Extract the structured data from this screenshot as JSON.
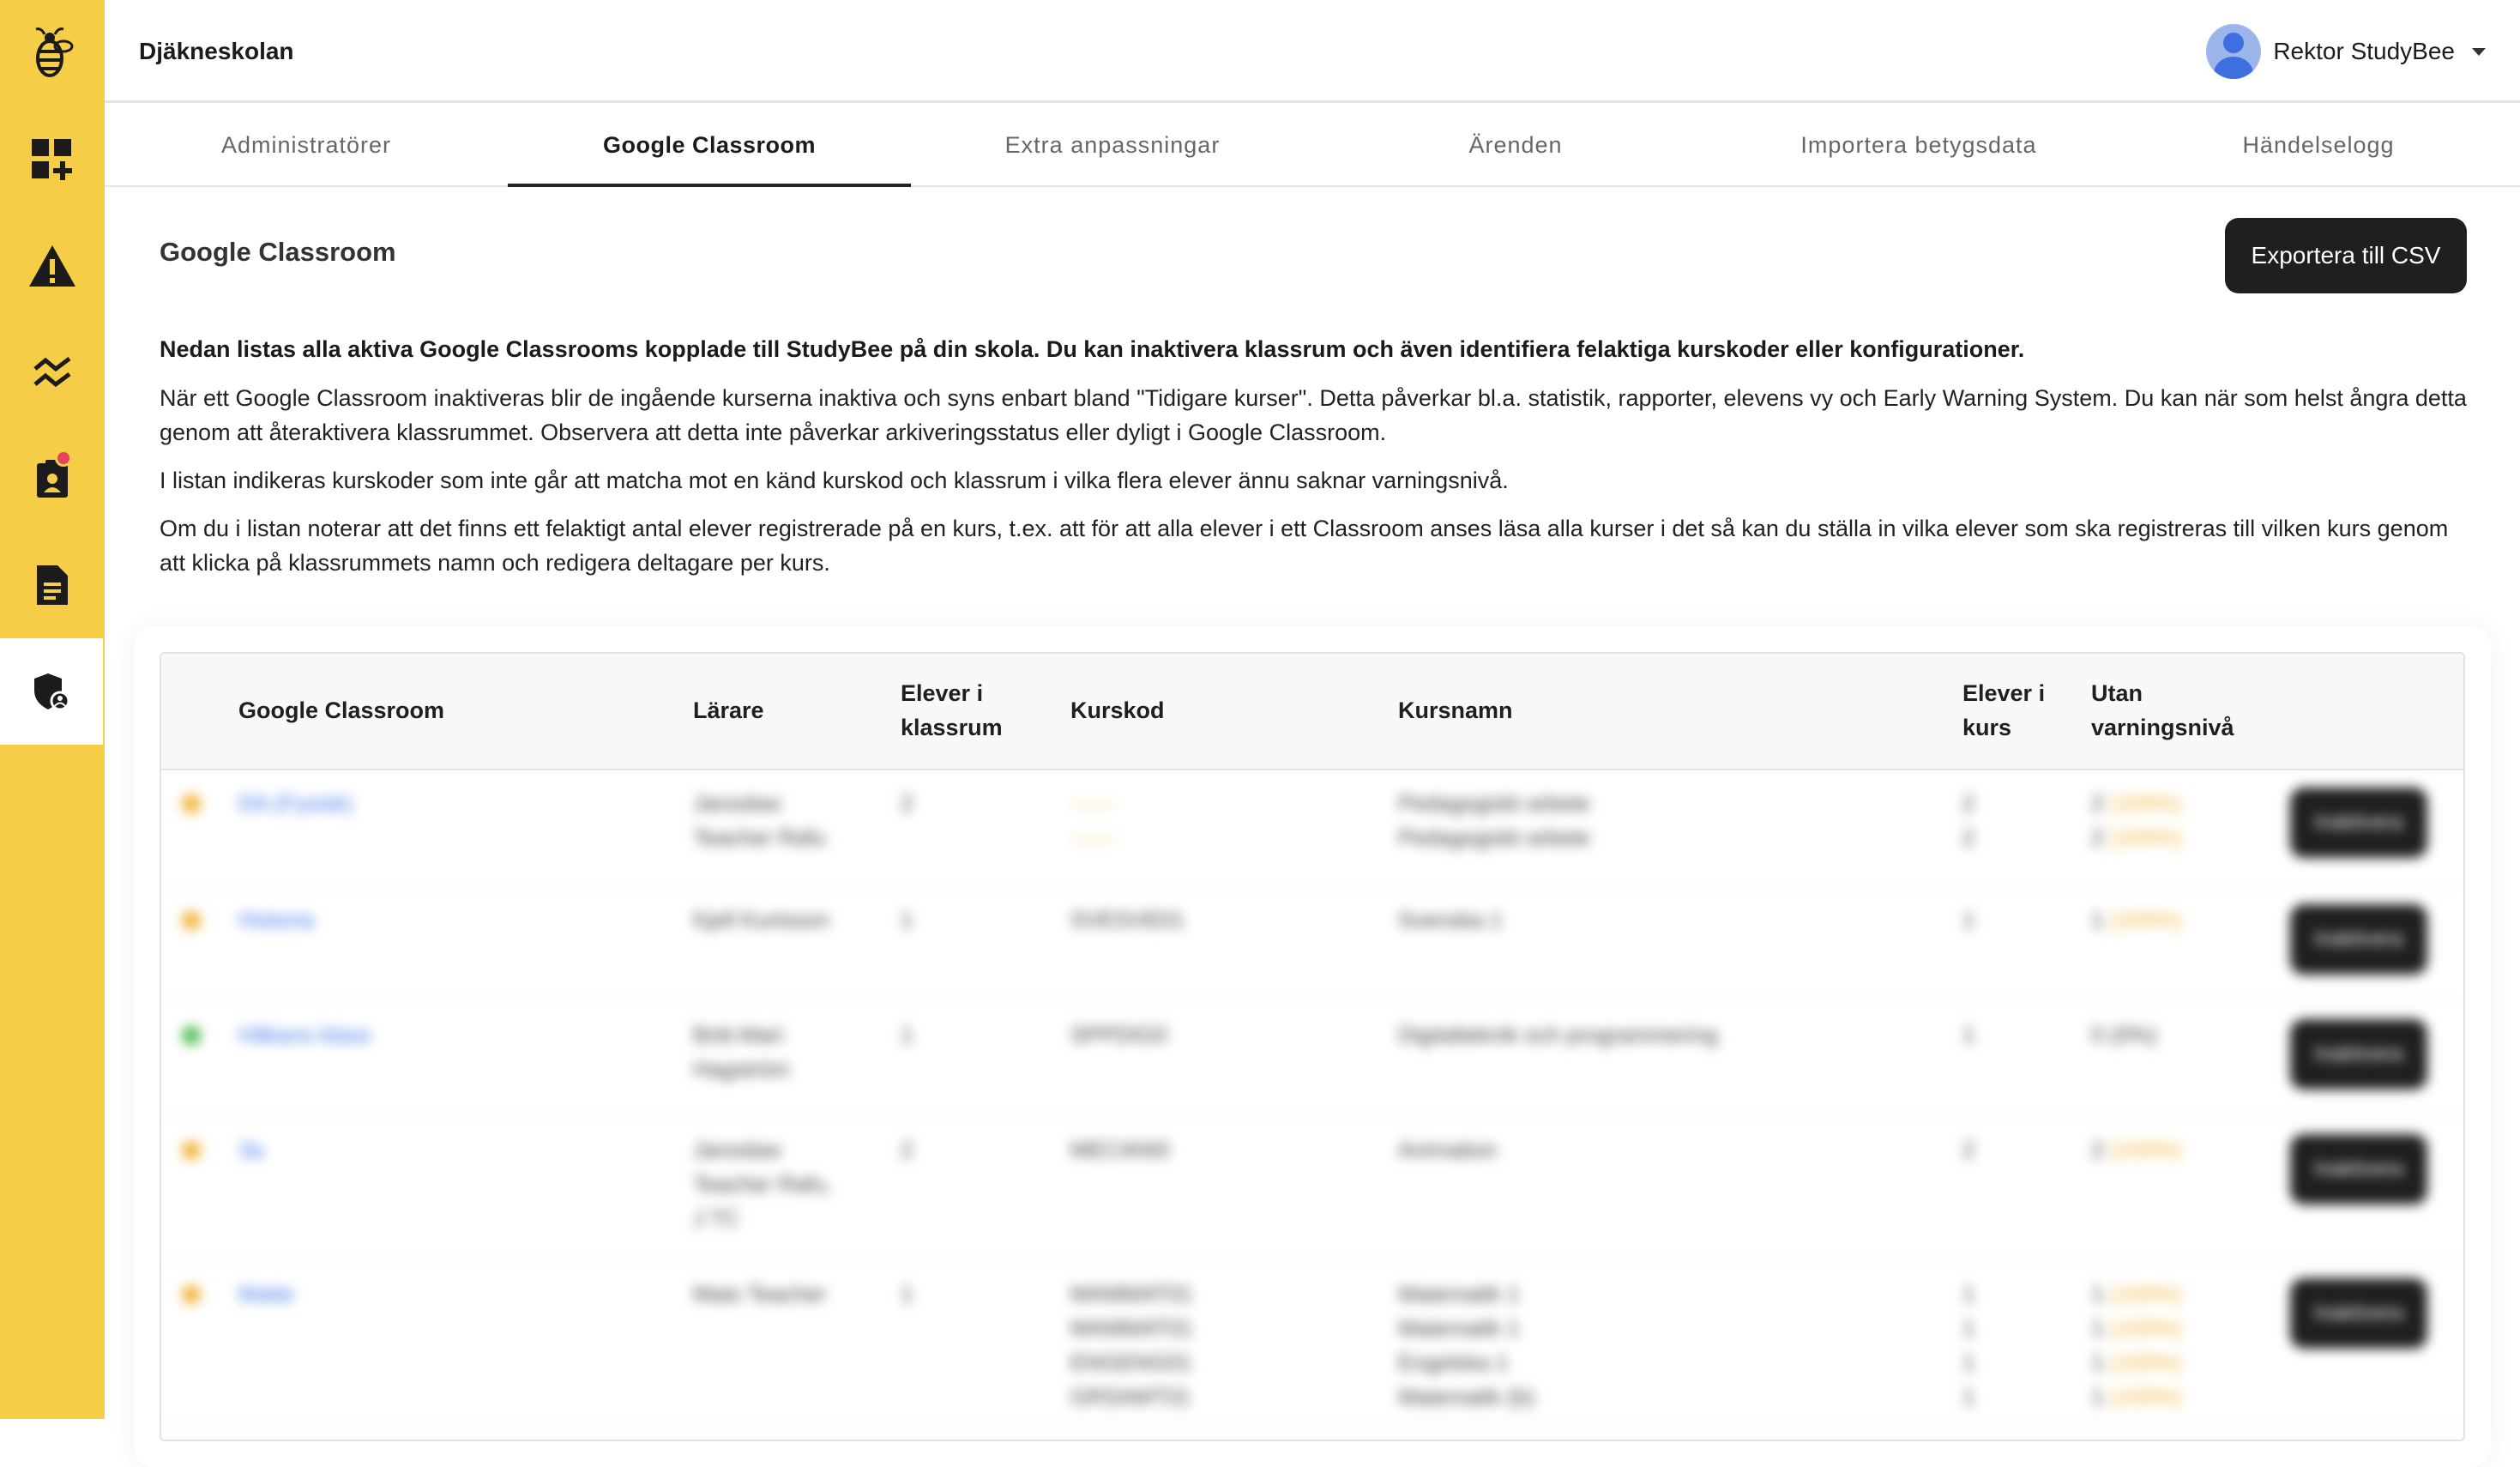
{
  "app": {
    "school_name": "Djäkneskolan"
  },
  "user": {
    "name": "Rektor StudyBee"
  },
  "sidebar": {
    "items": [
      {
        "icon": "bee-logo-icon"
      },
      {
        "icon": "dashboard-add-icon"
      },
      {
        "icon": "warning-icon"
      },
      {
        "icon": "trend-icon"
      },
      {
        "icon": "student-report-icon",
        "badge": true
      },
      {
        "icon": "document-icon"
      },
      {
        "icon": "admin-shield-icon",
        "active": true
      }
    ]
  },
  "tabs": [
    {
      "label": "Administratörer"
    },
    {
      "label": "Google Classroom",
      "active": true
    },
    {
      "label": "Extra anpassningar"
    },
    {
      "label": "Ärenden"
    },
    {
      "label": "Importera betygsdata"
    },
    {
      "label": "Händelselogg"
    }
  ],
  "page": {
    "title": "Google Classroom",
    "export_label": "Exportera till CSV",
    "intro_bold": "Nedan listas alla aktiva Google Classrooms kopplade till StudyBee på din skola. Du kan inaktivera klassrum och även identifiera felaktiga kurskoder eller konfigurationer.",
    "para1": "När ett Google Classroom inaktiveras blir de ingående kurserna inaktiva och syns enbart bland \"Tidigare kurser\". Detta påverkar bl.a. statistik, rapporter, elevens vy och Early Warning System. Du kan när som helst ångra detta genom att återaktivera klassrummet. Observera att detta inte påverkar arkiveringsstatus eller dyligt i Google Classroom.",
    "para2": "I listan indikeras kurskoder som inte går att matcha mot en känd kurskod och klassrum i vilka flera elever ännu saknar varningsnivå.",
    "para3": "Om du i listan noterar att det finns ett felaktigt antal elever registrerade på en kurs, t.ex. att för att alla elever i ett Classroom anses läsa alla kurser i det så kan du ställa in vilka elever som ska registreras till vilken kurs genom att klicka på klassrummets namn och redigera deltagare per kurs."
  },
  "table": {
    "headers": {
      "classroom": "Google Classroom",
      "teacher": "Lärare",
      "students_classroom": [
        "Elever i",
        "klassrum"
      ],
      "course_code": "Kurskod",
      "course_name": "Kursnamn",
      "students_course": [
        "Elever i",
        "kurs"
      ],
      "no_warning": [
        "Utan",
        "varningsnivå"
      ]
    },
    "status_colors": {
      "warn": "#f2b236",
      "ok": "#4cbb4c"
    },
    "rows": [
      {
        "status": "warn",
        "classroom": "DA (Fysisk)",
        "teachers": [
          "Jaroslaw",
          "Teacher Rafu"
        ],
        "students": "2",
        "codes": [
          "------",
          "------"
        ],
        "codes_warn": true,
        "names": [
          "Pedagogiskt arbete",
          "Pedagogiskt arbete"
        ],
        "course_students": [
          "2",
          "2"
        ],
        "no_warning": [
          "2",
          "2"
        ],
        "no_warning_pct": [
          "(100%)",
          "(100%)"
        ],
        "action": "Inaktivera"
      },
      {
        "status": "warn",
        "classroom": "Historia",
        "teachers": [
          "Kjell Kurtsson"
        ],
        "students": "1",
        "codes": [
          "SVESVE01"
        ],
        "codes_warn": false,
        "names": [
          "Svenska 1"
        ],
        "course_students": [
          "1"
        ],
        "no_warning": [
          "1"
        ],
        "no_warning_pct": [
          "(100%)"
        ],
        "action": "Inaktivera"
      },
      {
        "status": "ok",
        "classroom": "Håkans klass",
        "teachers": [
          "Britt-Mari",
          "Hagström"
        ],
        "students": "1",
        "codes": [
          "SPPDIG0"
        ],
        "codes_warn": false,
        "names": [
          "Digitalteknik och programmering"
        ],
        "course_students": [
          "1"
        ],
        "no_warning": [
          "0"
        ],
        "no_warning_pct": [
          "(0%)"
        ],
        "action": "Inaktivera"
      },
      {
        "status": "warn",
        "classroom": "3a",
        "teachers": [
          "Jaroslaw",
          "Teacher Rafu,",
          "J TC"
        ],
        "students": "2",
        "codes": [
          "MECANI0"
        ],
        "codes_warn": false,
        "names": [
          "Animation"
        ],
        "course_students": [
          "2"
        ],
        "no_warning": [
          "2"
        ],
        "no_warning_pct": [
          "(100%)"
        ],
        "action": "Inaktivera"
      },
      {
        "status": "warn",
        "classroom": "Matte",
        "teachers": [
          "Mats Teacher"
        ],
        "students": "1",
        "codes": [
          "MAMMAT01",
          "MAMMAT01",
          "ENGENG01",
          "GRSAMT01"
        ],
        "codes_warn": false,
        "names": [
          "Matematik 1",
          "Matematik 1",
          "Engelska 1",
          "Matematik (b)"
        ],
        "course_students": [
          "1",
          "1",
          "1",
          "1"
        ],
        "no_warning": [
          "1",
          "1",
          "1",
          "1"
        ],
        "no_warning_pct": [
          "(100%)",
          "(100%)",
          "(100%)",
          "(100%)"
        ],
        "action": "Inaktivera"
      }
    ]
  }
}
